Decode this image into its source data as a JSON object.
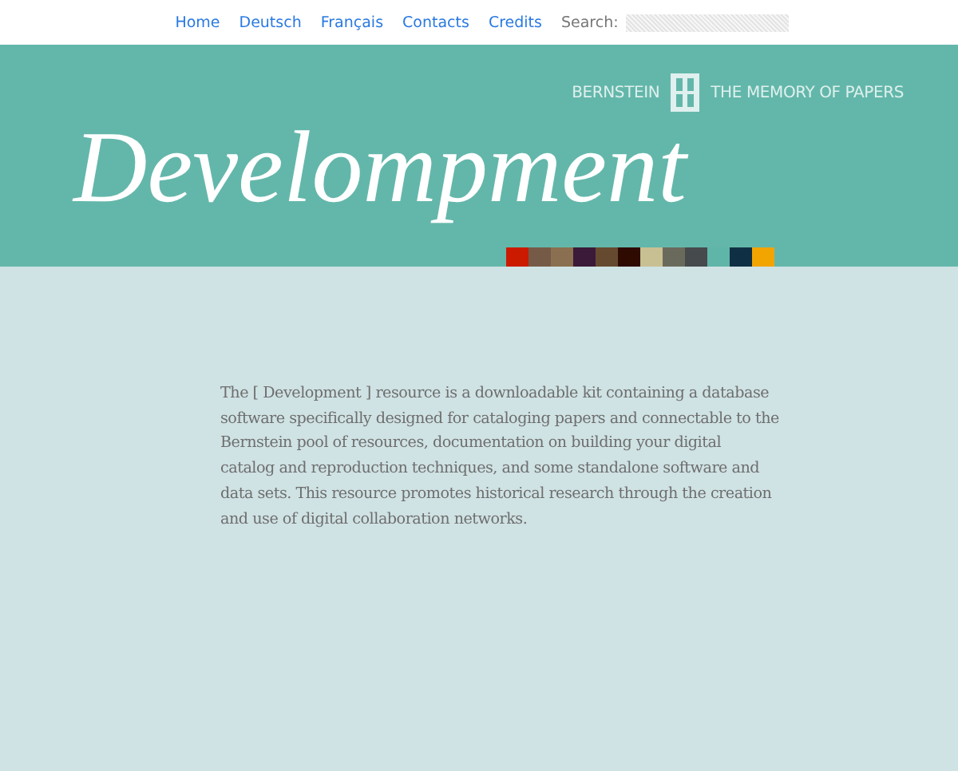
{
  "nav": {
    "links": [
      "Home",
      "Deutsch",
      "Français",
      "Contacts",
      "Credits"
    ],
    "search": {
      "label": "Search:"
    }
  },
  "header": {
    "brand": "BERNSTEIN",
    "tagline": "THE MEMORY OF PAPERS",
    "title": "Develompment",
    "swatches": [
      {
        "color": "#cc1a00"
      },
      {
        "color": "#765a48"
      },
      {
        "color": "#8a7050"
      },
      {
        "color": "#3a1a38"
      },
      {
        "color": "#654a30"
      },
      {
        "color": "#2e0a00"
      },
      {
        "color": "#c8c092"
      },
      {
        "color": "#6a6a5c"
      },
      {
        "color": "#464a4c"
      },
      {
        "color": "#5fb5a8"
      },
      {
        "color": "#0f3044"
      },
      {
        "color": "#f2a400"
      }
    ]
  },
  "intro": "The [ Development ] resource is a downloadable kit containing a database software specifically designed for cataloging papers and connectable to the Bernstein pool of resources, documentation on building your digital catalog and reproduction techniques, and some standalone software and data sets. This resource promotes historical research through the creation and use of digital collaboration networks."
}
